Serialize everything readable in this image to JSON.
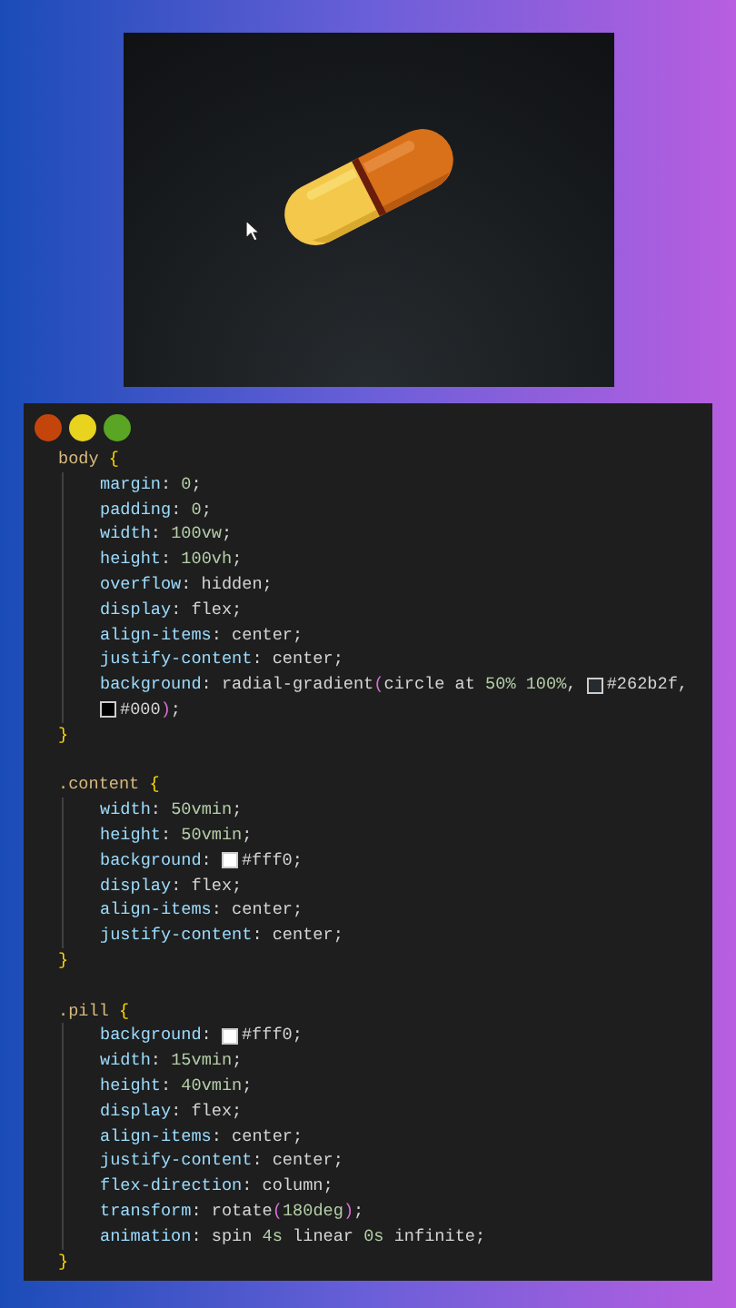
{
  "window_controls": [
    {
      "color": "#c4450c"
    },
    {
      "color": "#e8d31f"
    },
    {
      "color": "#5aa523"
    }
  ],
  "code": {
    "rules": [
      {
        "header": {
          "tokens": [
            {
              "kind": "sel",
              "text": "body "
            },
            {
              "kind": "brace",
              "text": "{"
            }
          ]
        },
        "children": [
          {
            "tokens": [
              {
                "kind": "prop",
                "text": "margin"
              },
              {
                "kind": "text",
                "text": ": "
              },
              {
                "kind": "num",
                "text": "0"
              },
              {
                "kind": "text",
                "text": ";"
              }
            ]
          },
          {
            "tokens": [
              {
                "kind": "prop",
                "text": "padding"
              },
              {
                "kind": "text",
                "text": ": "
              },
              {
                "kind": "num",
                "text": "0"
              },
              {
                "kind": "text",
                "text": ";"
              }
            ]
          },
          {
            "tokens": [
              {
                "kind": "prop",
                "text": "width"
              },
              {
                "kind": "text",
                "text": ": "
              },
              {
                "kind": "num",
                "text": "100vw"
              },
              {
                "kind": "text",
                "text": ";"
              }
            ]
          },
          {
            "tokens": [
              {
                "kind": "prop",
                "text": "height"
              },
              {
                "kind": "text",
                "text": ": "
              },
              {
                "kind": "num",
                "text": "100vh"
              },
              {
                "kind": "text",
                "text": ";"
              }
            ]
          },
          {
            "tokens": [
              {
                "kind": "prop",
                "text": "overflow"
              },
              {
                "kind": "text",
                "text": ": hidden;"
              }
            ]
          },
          {
            "tokens": [
              {
                "kind": "prop",
                "text": "display"
              },
              {
                "kind": "text",
                "text": ": flex;"
              }
            ]
          },
          {
            "tokens": [
              {
                "kind": "prop",
                "text": "align-items"
              },
              {
                "kind": "text",
                "text": ": center;"
              }
            ]
          },
          {
            "tokens": [
              {
                "kind": "prop",
                "text": "justify-content"
              },
              {
                "kind": "text",
                "text": ": center;"
              }
            ]
          },
          {
            "tokens": [
              {
                "kind": "prop",
                "text": "background"
              },
              {
                "kind": "text",
                "text": ": radial-gradient"
              },
              {
                "kind": "paren",
                "text": "("
              },
              {
                "kind": "text",
                "text": "circle at "
              },
              {
                "kind": "num",
                "text": "50% 100%"
              },
              {
                "kind": "text",
                "text": ", "
              },
              {
                "kind": "swatch",
                "color": "#262b2f"
              },
              {
                "kind": "text",
                "text": "#262b2f,"
              }
            ]
          },
          {
            "tokens": [
              {
                "kind": "swatch",
                "color": "#000000"
              },
              {
                "kind": "text",
                "text": "#000"
              },
              {
                "kind": "paren",
                "text": ")"
              },
              {
                "kind": "text",
                "text": ";"
              }
            ]
          }
        ],
        "footer": {
          "tokens": [
            {
              "kind": "brace",
              "text": "}"
            }
          ]
        }
      },
      {
        "header": {
          "tokens": [
            {
              "kind": "sel",
              "text": ".content "
            },
            {
              "kind": "brace",
              "text": "{"
            }
          ]
        },
        "children": [
          {
            "tokens": [
              {
                "kind": "prop",
                "text": "width"
              },
              {
                "kind": "text",
                "text": ": "
              },
              {
                "kind": "num",
                "text": "50vmin"
              },
              {
                "kind": "text",
                "text": ";"
              }
            ]
          },
          {
            "tokens": [
              {
                "kind": "prop",
                "text": "height"
              },
              {
                "kind": "text",
                "text": ": "
              },
              {
                "kind": "num",
                "text": "50vmin"
              },
              {
                "kind": "text",
                "text": ";"
              }
            ]
          },
          {
            "tokens": [
              {
                "kind": "prop",
                "text": "background"
              },
              {
                "kind": "text",
                "text": ": "
              },
              {
                "kind": "swatch",
                "color": "#ffffff"
              },
              {
                "kind": "text",
                "text": "#fff0;"
              }
            ]
          },
          {
            "tokens": [
              {
                "kind": "prop",
                "text": "display"
              },
              {
                "kind": "text",
                "text": ": flex;"
              }
            ]
          },
          {
            "tokens": [
              {
                "kind": "prop",
                "text": "align-items"
              },
              {
                "kind": "text",
                "text": ": center;"
              }
            ]
          },
          {
            "tokens": [
              {
                "kind": "prop",
                "text": "justify-content"
              },
              {
                "kind": "text",
                "text": ": center;"
              }
            ]
          }
        ],
        "footer": {
          "tokens": [
            {
              "kind": "brace",
              "text": "}"
            }
          ]
        }
      },
      {
        "header": {
          "tokens": [
            {
              "kind": "sel",
              "text": ".pill "
            },
            {
              "kind": "brace",
              "text": "{"
            }
          ]
        },
        "children": [
          {
            "tokens": [
              {
                "kind": "prop",
                "text": "background"
              },
              {
                "kind": "text",
                "text": ": "
              },
              {
                "kind": "swatch",
                "color": "#ffffff"
              },
              {
                "kind": "text",
                "text": "#fff0;"
              }
            ]
          },
          {
            "tokens": [
              {
                "kind": "prop",
                "text": "width"
              },
              {
                "kind": "text",
                "text": ": "
              },
              {
                "kind": "num",
                "text": "15vmin"
              },
              {
                "kind": "text",
                "text": ";"
              }
            ]
          },
          {
            "tokens": [
              {
                "kind": "prop",
                "text": "height"
              },
              {
                "kind": "text",
                "text": ": "
              },
              {
                "kind": "num",
                "text": "40vmin"
              },
              {
                "kind": "text",
                "text": ";"
              }
            ]
          },
          {
            "tokens": [
              {
                "kind": "prop",
                "text": "display"
              },
              {
                "kind": "text",
                "text": ": flex;"
              }
            ]
          },
          {
            "tokens": [
              {
                "kind": "prop",
                "text": "align-items"
              },
              {
                "kind": "text",
                "text": ": center;"
              }
            ]
          },
          {
            "tokens": [
              {
                "kind": "prop",
                "text": "justify-content"
              },
              {
                "kind": "text",
                "text": ": center;"
              }
            ]
          },
          {
            "tokens": [
              {
                "kind": "prop",
                "text": "flex-direction"
              },
              {
                "kind": "text",
                "text": ": column;"
              }
            ]
          },
          {
            "tokens": [
              {
                "kind": "prop",
                "text": "transform"
              },
              {
                "kind": "text",
                "text": ": rotate"
              },
              {
                "kind": "paren",
                "text": "("
              },
              {
                "kind": "num",
                "text": "180deg"
              },
              {
                "kind": "paren",
                "text": ")"
              },
              {
                "kind": "text",
                "text": ";"
              }
            ]
          },
          {
            "tokens": [
              {
                "kind": "prop",
                "text": "animation"
              },
              {
                "kind": "text",
                "text": ": spin "
              },
              {
                "kind": "num",
                "text": "4s"
              },
              {
                "kind": "text",
                "text": " linear "
              },
              {
                "kind": "num",
                "text": "0s"
              },
              {
                "kind": "text",
                "text": " infinite;"
              }
            ]
          }
        ],
        "footer": {
          "tokens": [
            {
              "kind": "brace",
              "text": "}"
            }
          ]
        }
      }
    ]
  }
}
